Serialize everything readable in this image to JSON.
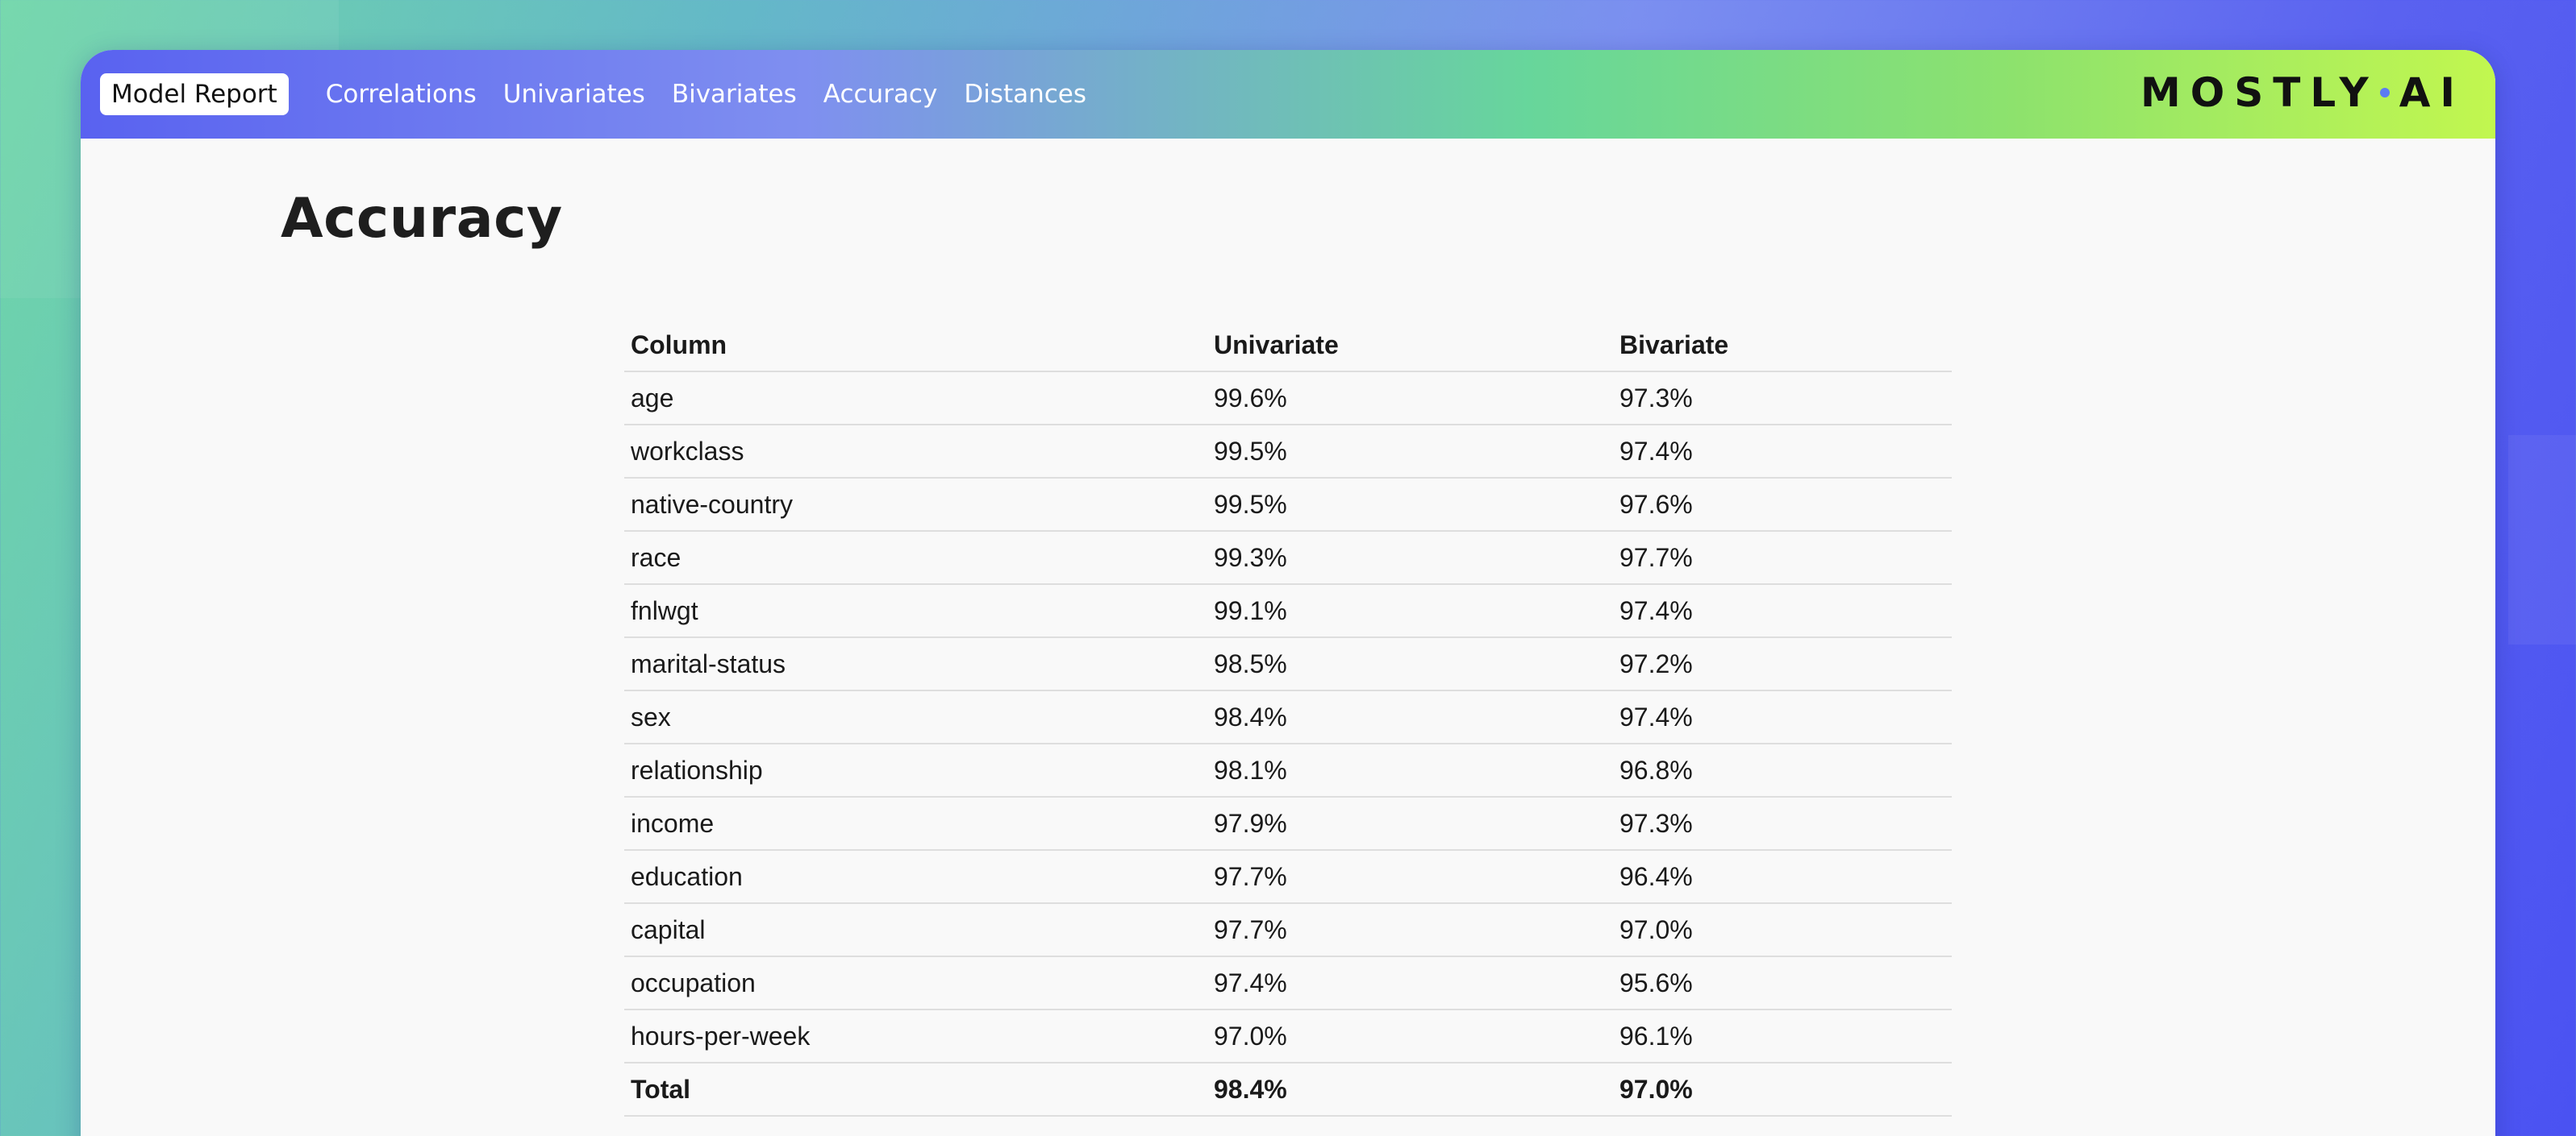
{
  "nav": {
    "brand": "Model Report",
    "links": [
      "Correlations",
      "Univariates",
      "Bivariates",
      "Accuracy",
      "Distances"
    ],
    "logo_a": "MOSTLY",
    "logo_b": "AI"
  },
  "page": {
    "title": "Accuracy"
  },
  "table": {
    "headers": [
      "Column",
      "Univariate",
      "Bivariate"
    ],
    "rows": [
      [
        "age",
        "99.6%",
        "97.3%"
      ],
      [
        "workclass",
        "99.5%",
        "97.4%"
      ],
      [
        "native-country",
        "99.5%",
        "97.6%"
      ],
      [
        "race",
        "99.3%",
        "97.7%"
      ],
      [
        "fnlwgt",
        "99.1%",
        "97.4%"
      ],
      [
        "marital-status",
        "98.5%",
        "97.2%"
      ],
      [
        "sex",
        "98.4%",
        "97.4%"
      ],
      [
        "relationship",
        "98.1%",
        "96.8%"
      ],
      [
        "income",
        "97.9%",
        "97.3%"
      ],
      [
        "education",
        "97.7%",
        "96.4%"
      ],
      [
        "capital",
        "97.7%",
        "97.0%"
      ],
      [
        "occupation",
        "97.4%",
        "95.6%"
      ],
      [
        "hours-per-week",
        "97.0%",
        "96.1%"
      ]
    ],
    "total": [
      "Total",
      "98.4%",
      "97.0%"
    ]
  },
  "colors": {
    "nav_gradient_start": "#5962f0",
    "nav_gradient_end": "#c2f74f",
    "page_background": "#f9f9f9",
    "text": "#1a1a1a"
  }
}
